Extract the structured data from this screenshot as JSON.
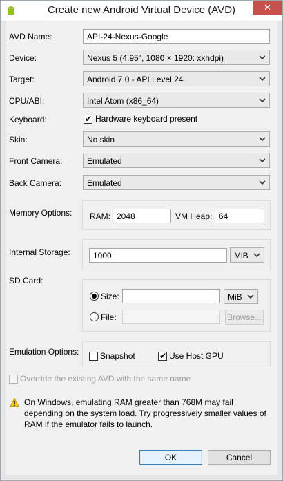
{
  "window": {
    "title": "Create new Android Virtual Device (AVD)",
    "close_glyph": "✕"
  },
  "fields": {
    "avd_name": {
      "label": "AVD Name:",
      "value": "API-24-Nexus-Google"
    },
    "device": {
      "label": "Device:",
      "value": "Nexus 5 (4.95\", 1080 × 1920: xxhdpi)"
    },
    "target": {
      "label": "Target:",
      "value": "Android 7.0 - API Level 24"
    },
    "cpu_abi": {
      "label": "CPU/ABI:",
      "value": "Intel Atom (x86_64)"
    },
    "keyboard": {
      "label": "Keyboard:",
      "checkbox_label": "Hardware keyboard present",
      "checked": true
    },
    "skin": {
      "label": "Skin:",
      "value": "No skin"
    },
    "front_camera": {
      "label": "Front Camera:",
      "value": "Emulated"
    },
    "back_camera": {
      "label": "Back Camera:",
      "value": "Emulated"
    }
  },
  "memory": {
    "label": "Memory Options:",
    "ram_label": "RAM:",
    "ram_value": "2048",
    "vm_heap_label": "VM Heap:",
    "vm_heap_value": "64"
  },
  "internal_storage": {
    "label": "Internal Storage:",
    "value": "1000",
    "unit": "MiB"
  },
  "sd_card": {
    "label": "SD Card:",
    "size_label": "Size:",
    "size_value": "",
    "size_unit": "MiB",
    "size_selected": true,
    "file_label": "File:",
    "file_value": "",
    "browse_label": "Browse..."
  },
  "emulation": {
    "label": "Emulation Options:",
    "snapshot_label": "Snapshot",
    "snapshot_checked": false,
    "host_gpu_label": "Use Host GPU",
    "host_gpu_checked": true
  },
  "override": {
    "label": "Override the existing AVD with the same name",
    "checked": false
  },
  "warning": {
    "text": "On Windows, emulating RAM greater than 768M may fail depending on the system load. Try progressively smaller values of RAM if the emulator fails to launch."
  },
  "buttons": {
    "ok": "OK",
    "cancel": "Cancel"
  },
  "icons": {
    "app": "android-app-icon",
    "warning": "warning-triangle-icon",
    "dropdown": "chevron-down-icon",
    "check": "checkmark-icon"
  },
  "colors": {
    "close_button": "#c7504a",
    "default_button_border": "#3c7fb1",
    "warning_yellow": "#f5c518"
  }
}
